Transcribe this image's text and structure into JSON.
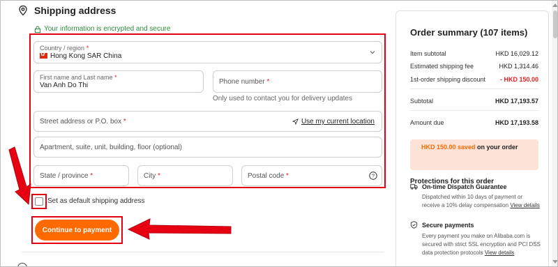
{
  "header": {
    "title": "Shipping address",
    "icon": "location-pin-icon"
  },
  "security_note": "Your information is encrypted and secure",
  "form": {
    "country": {
      "label": "Country / region",
      "value": "Hong Kong SAR China"
    },
    "name": {
      "label": "First name and Last name",
      "value": "Van Anh Do Thi"
    },
    "phone": {
      "placeholder": "Phone number",
      "hint": "Only used to contact you for delivery updates"
    },
    "street": {
      "placeholder": "Street address or P.O. box",
      "location_link": "Use my current location"
    },
    "apartment": {
      "placeholder": "Apartment, suite, unit, building, floor (optional)"
    },
    "state": {
      "placeholder": "State / province"
    },
    "city": {
      "placeholder": "City"
    },
    "postal": {
      "placeholder": "Postal code"
    },
    "required_mark": "*"
  },
  "default_checkbox": {
    "label": "Set as default shipping address",
    "checked": false
  },
  "continue_button": "Continue to payment",
  "summary": {
    "title": "Order summary (107 items)",
    "rows": [
      {
        "label": "Item subtotal",
        "value": "HKD 16,029.12"
      },
      {
        "label": "Estimated shipping fee",
        "value": "HKD 1,314.46"
      },
      {
        "label": "1st-order shipping discount",
        "value": "- HKD 150.00"
      }
    ],
    "subtotal": {
      "label": "Subtotal",
      "value": "HKD 17,193.57"
    },
    "amount_due": {
      "label": "Amount due",
      "value": "HKD 17,193.58"
    },
    "saved": {
      "amount": "HKD 150.00 saved",
      "rest": " on your order"
    },
    "protections_title": "Protections for this order",
    "protections": [
      {
        "title": "On-time Dispatch Guarantee",
        "text": "Dispatched within 10 days of payment or receive a 10% delay compensation",
        "link": "View details",
        "icon": "truck-icon"
      },
      {
        "title": "Secure payments",
        "text": "Every payment you make on Alibaba.com is secured with strict SSL encryption and PCI DSS data protection protocols",
        "link": "View details",
        "icon": "shield-icon"
      }
    ]
  },
  "colors": {
    "accent": "#ff6a00",
    "annotation_red": "#e60012",
    "secure_green": "#2e8b3a",
    "discount_red": "#e02020"
  }
}
